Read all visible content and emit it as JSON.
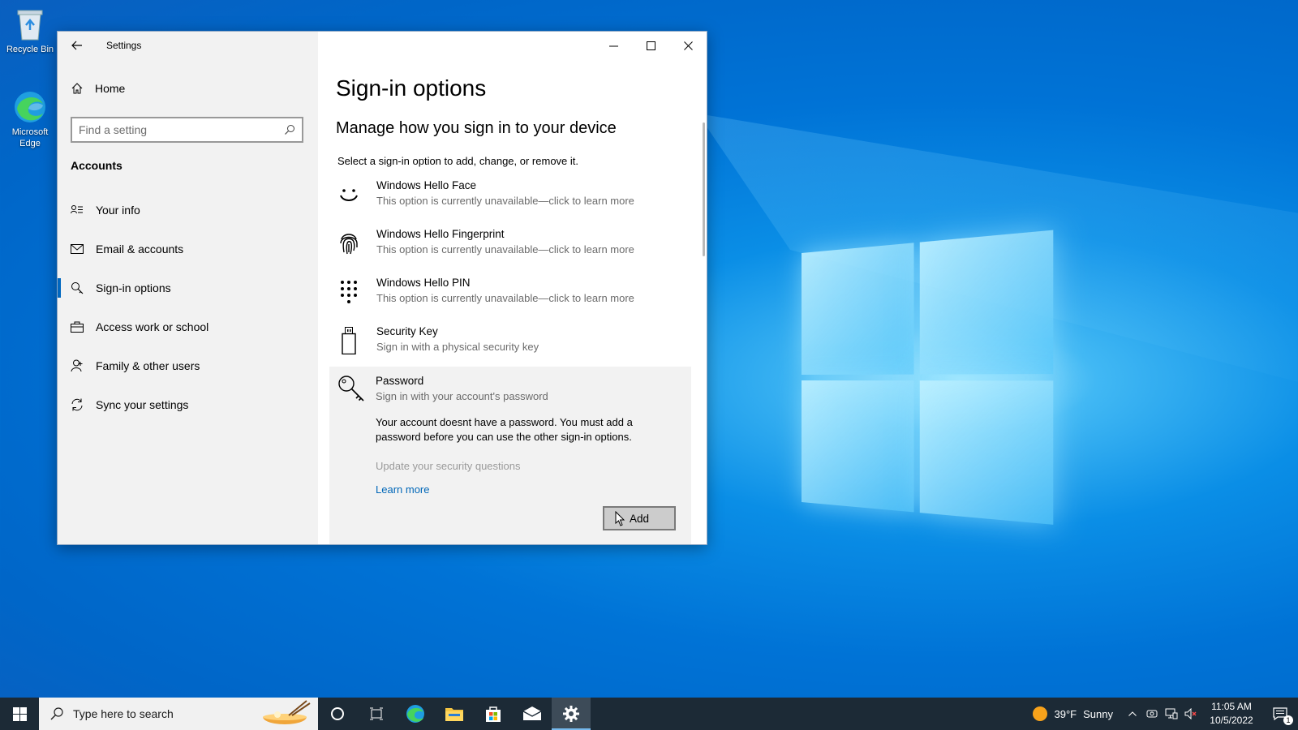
{
  "desktop": {
    "icons": [
      {
        "label": "Recycle Bin"
      },
      {
        "label": "Microsoft Edge"
      }
    ]
  },
  "window": {
    "title": "Settings",
    "sidebar": {
      "home": "Home",
      "search_placeholder": "Find a setting",
      "section_title": "Accounts",
      "items": [
        {
          "label": "Your info",
          "icon": "contact-icon"
        },
        {
          "label": "Email & accounts",
          "icon": "mail-icon"
        },
        {
          "label": "Sign-in options",
          "icon": "key-icon",
          "active": true
        },
        {
          "label": "Access work or school",
          "icon": "briefcase-icon"
        },
        {
          "label": "Family & other users",
          "icon": "person-add-icon"
        },
        {
          "label": "Sync your settings",
          "icon": "sync-icon"
        }
      ]
    },
    "content": {
      "title": "Sign-in options",
      "subtitle": "Manage how you sign in to your device",
      "hint": "Select a sign-in option to add, change, or remove it.",
      "options": [
        {
          "title": "Windows Hello Face",
          "sub": "This option is currently unavailable—click to learn more"
        },
        {
          "title": "Windows Hello Fingerprint",
          "sub": "This option is currently unavailable—click to learn more"
        },
        {
          "title": "Windows Hello PIN",
          "sub": "This option is currently unavailable—click to learn more"
        },
        {
          "title": "Security Key",
          "sub": "Sign in with a physical security key"
        }
      ],
      "password": {
        "title": "Password",
        "sub": "Sign in with your account's password",
        "message": "Your account doesnt have a password. You must add a password before you can use the other sign-in options.",
        "security_questions": "Update your security questions",
        "learn_more": "Learn more",
        "add_button": "Add"
      }
    }
  },
  "taskbar": {
    "search_placeholder": "Type here to search",
    "weather": {
      "temp": "39°F",
      "condition": "Sunny"
    },
    "time": "11:05 AM",
    "date": "10/5/2022",
    "notification_count": "1"
  }
}
